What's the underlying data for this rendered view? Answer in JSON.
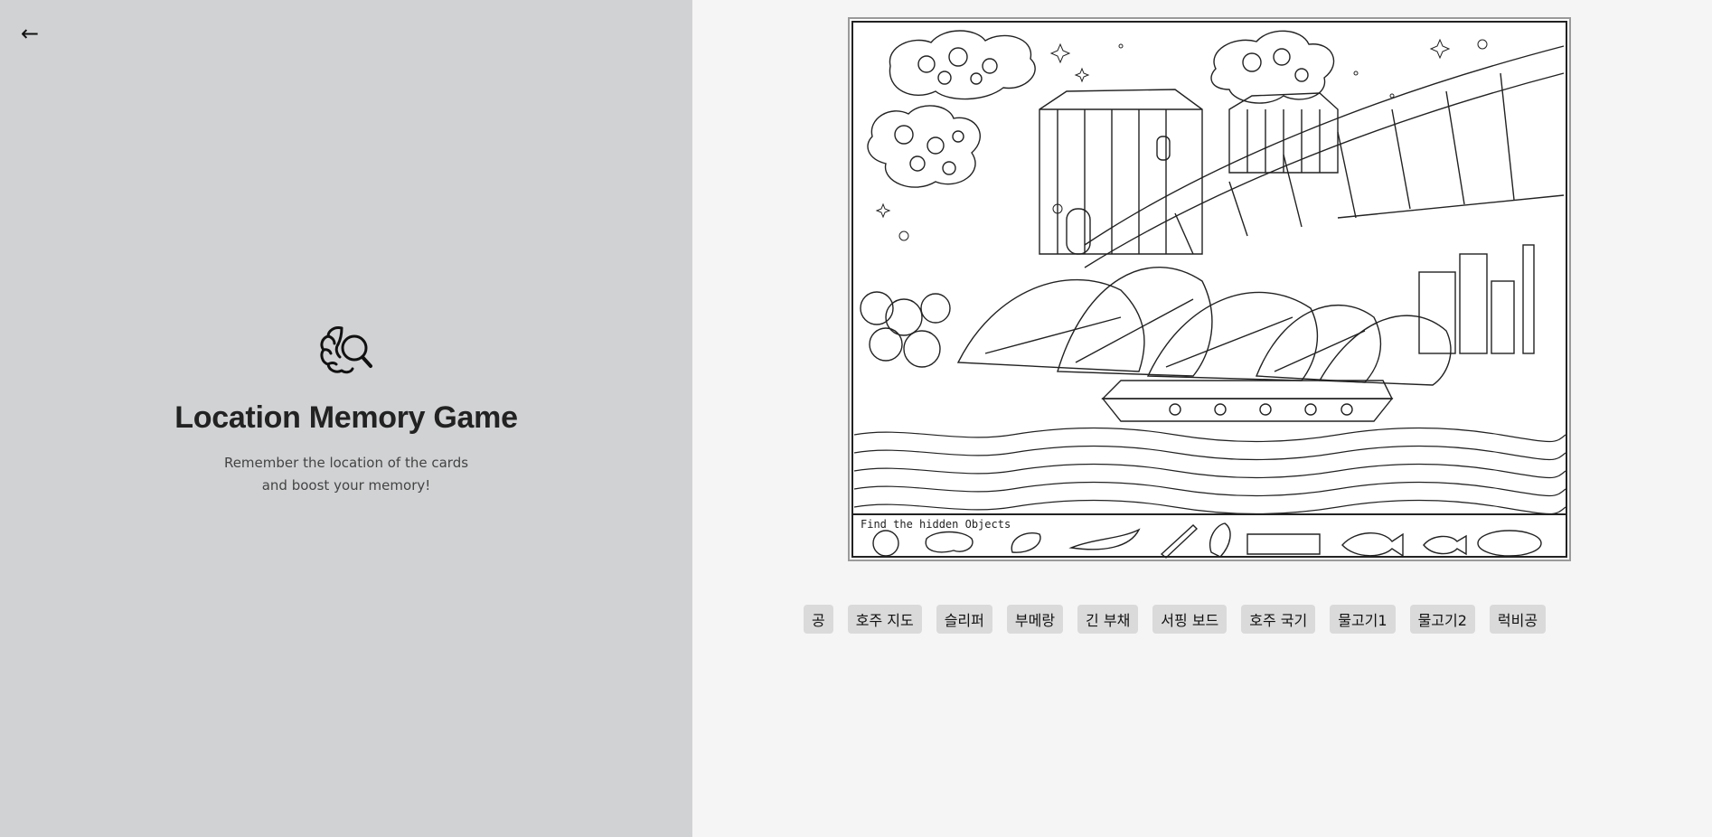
{
  "header": {
    "back_icon": "arrow-left-icon"
  },
  "intro": {
    "icon": "brain-magnifier-icon",
    "title": "Location Memory Game",
    "subtitle_line1": "Remember the location of the cards",
    "subtitle_line2": "and boost your memory!"
  },
  "puzzle": {
    "caption": "Find the hidden Objects",
    "scene": "sydney-opera-house-harbour-bridge-coloring-page"
  },
  "objects": [
    {
      "label": "공"
    },
    {
      "label": "호주 지도"
    },
    {
      "label": "슬리퍼"
    },
    {
      "label": "부메랑"
    },
    {
      "label": "긴 부채"
    },
    {
      "label": "서핑 보드"
    },
    {
      "label": "호주 국기"
    },
    {
      "label": "물고기1"
    },
    {
      "label": "물고기2"
    },
    {
      "label": "럭비공"
    }
  ],
  "colors": {
    "left_bg": "#d1d2d4",
    "right_bg": "#f5f5f6",
    "chip_bg": "#dadadb",
    "title": "#222222"
  }
}
